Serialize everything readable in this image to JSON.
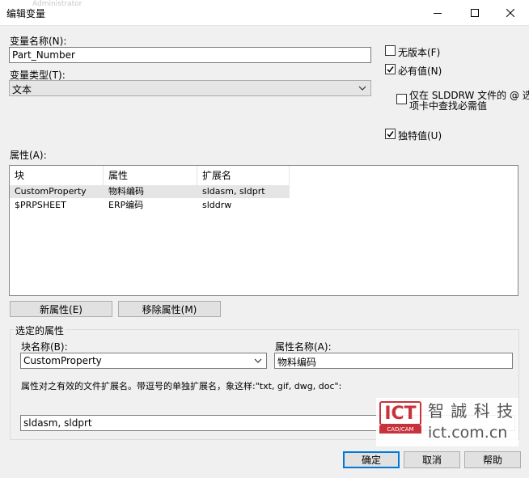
{
  "window": {
    "title": "编辑变量",
    "ghost_text": "Administrator",
    "controls": {
      "minimize": "minimize-icon",
      "maximize": "maximize-icon",
      "close": "close-icon"
    }
  },
  "variable_name": {
    "label": "变量名称(N):",
    "value": "Part_Number"
  },
  "variable_type": {
    "label": "变量类型(T):",
    "selected": "文本"
  },
  "options": {
    "no_version": {
      "label": "无版本(F)",
      "checked": false
    },
    "required": {
      "label": "必有值(N)",
      "checked": true
    },
    "slddrw_only": {
      "label_line1": "仅在 SLDDRW 文件的 @ 选",
      "label_line2": "项卡中查找必需值",
      "checked": false
    },
    "unique": {
      "label": "独特值(U)",
      "checked": true
    }
  },
  "attributes": {
    "label": "属性(A):",
    "columns": [
      "块",
      "属性",
      "扩展名"
    ],
    "rows": [
      {
        "block": "CustomProperty",
        "attribute": "物料编码",
        "ext": "sldasm, sldprt"
      },
      {
        "block": "$PRPSHEET",
        "attribute": "ERP编码",
        "ext": "slddrw"
      }
    ],
    "new_button": "新属性(E)",
    "remove_button": "移除属性(M)"
  },
  "selected_attribute": {
    "group_title": "选定的属性",
    "block_name_label": "块名称(B):",
    "block_name_value": "CustomProperty",
    "attr_name_label": "属性名称(A):",
    "attr_name_value": "物料编码",
    "extensions_hint": "属性对之有效的文件扩展名。带逗号的单独扩展名，象这样:\"txt, gif, dwg, doc\":",
    "extensions_value": "sldasm, sldprt"
  },
  "buttons": {
    "ok": "确定",
    "cancel": "取消",
    "help": "帮助"
  },
  "watermark": {
    "logo": "ICT",
    "logo_sub": "CAD/CAM",
    "company": "智 誠 科 技",
    "url": "ict.com.cn",
    "color": "#c8323c"
  }
}
